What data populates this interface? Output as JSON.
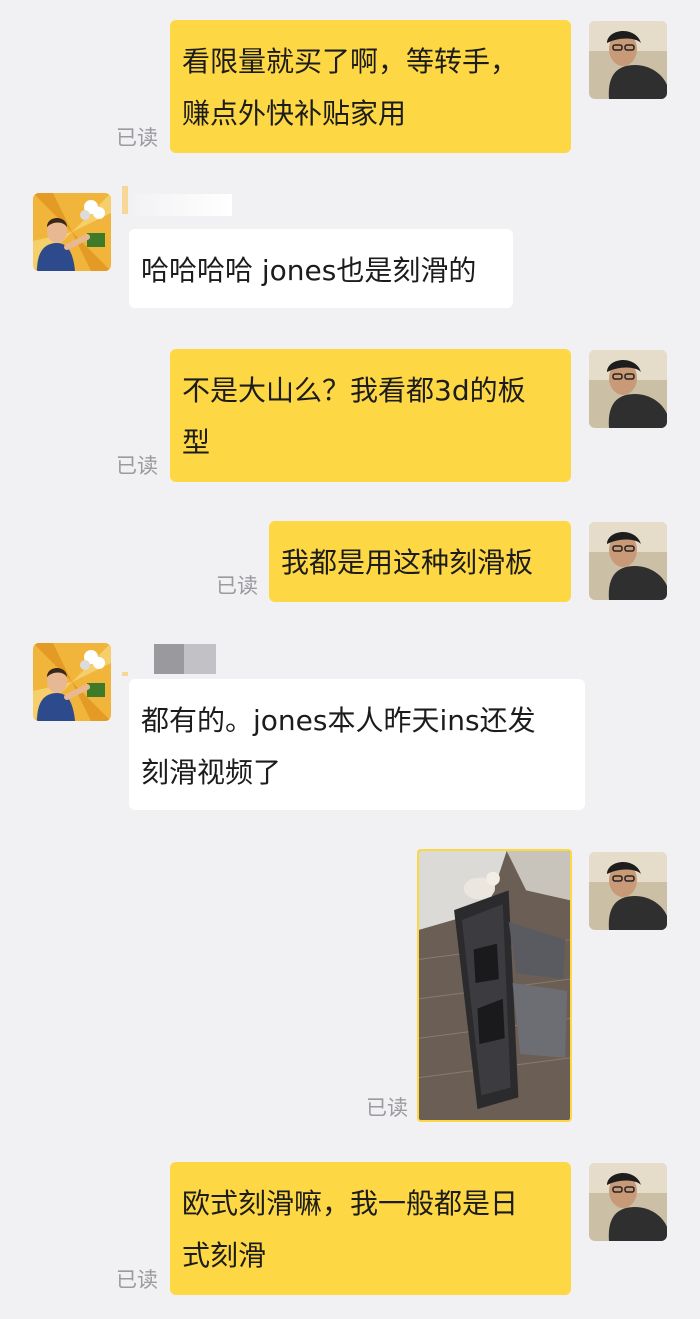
{
  "messages": [
    {
      "side": "out",
      "lines": [
        "看限量就买了啊，等转手，",
        "赚点外快补贴家用"
      ],
      "status": "已读"
    },
    {
      "side": "in",
      "lines": [
        "哈哈哈哈 jones也是刻滑的"
      ]
    },
    {
      "side": "out",
      "lines": [
        "不是大山么？我看都3d的板",
        "型"
      ],
      "status": "已读"
    },
    {
      "side": "out",
      "lines": [
        "我都是用这种刻滑板"
      ],
      "status": "已读"
    },
    {
      "side": "in",
      "lines": [
        "都有的。jones本人昨天ins还发",
        "刻滑视频了"
      ]
    },
    {
      "side": "out",
      "type": "image",
      "image": "snowboard-bag-photo",
      "status": "已读"
    },
    {
      "side": "out",
      "lines": [
        "欧式刻滑嘛，我一般都是日",
        "式刻滑"
      ],
      "status": "已读"
    }
  ],
  "colors": {
    "background": "#f1f1f4",
    "outgoing_bubble": "#fdd744",
    "incoming_bubble": "#ffffff",
    "read_status": "#9a9a9f"
  }
}
